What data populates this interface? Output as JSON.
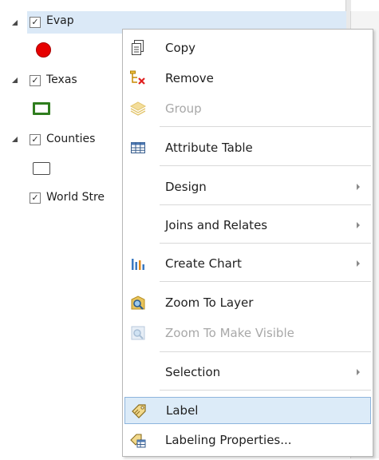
{
  "contents": {
    "layers": [
      {
        "name": "Evap",
        "checked": true,
        "expanded": true,
        "selected": true,
        "symbol": "red-circle"
      },
      {
        "name": "Texas",
        "checked": true,
        "expanded": true,
        "selected": false,
        "symbol": "green-outline-rect"
      },
      {
        "name": "Counties",
        "checked": true,
        "expanded": true,
        "selected": false,
        "symbol": "black-outline-rect"
      },
      {
        "name": "World Stre",
        "checked": true,
        "expanded": false,
        "selected": false,
        "symbol": ""
      }
    ]
  },
  "context_menu": {
    "items": [
      {
        "label": "Copy",
        "icon": "copy-icon",
        "enabled": true,
        "submenu": false
      },
      {
        "label": "Remove",
        "icon": "remove-layer-icon",
        "enabled": true,
        "submenu": false
      },
      {
        "label": "Group",
        "icon": "group-layers-icon",
        "enabled": false,
        "submenu": false
      },
      {
        "label": "Attribute Table",
        "icon": "table-icon",
        "enabled": true,
        "submenu": false
      },
      {
        "label": "Design",
        "icon": "",
        "enabled": true,
        "submenu": true
      },
      {
        "label": "Joins and Relates",
        "icon": "",
        "enabled": true,
        "submenu": true
      },
      {
        "label": "Create Chart",
        "icon": "bar-chart-icon",
        "enabled": true,
        "submenu": true
      },
      {
        "label": "Zoom To Layer",
        "icon": "zoom-to-layer-icon",
        "enabled": true,
        "submenu": false
      },
      {
        "label": "Zoom To Make Visible",
        "icon": "zoom-to-visible-icon",
        "enabled": false,
        "submenu": false
      },
      {
        "label": "Selection",
        "icon": "",
        "enabled": true,
        "submenu": true
      },
      {
        "label": "Label",
        "icon": "label-icon",
        "enabled": true,
        "submenu": false,
        "highlighted": true
      },
      {
        "label": "Labeling Properties...",
        "icon": "labeling-properties-icon",
        "enabled": true,
        "submenu": false
      }
    ]
  },
  "colors": {
    "selection": "#dbe9f7",
    "hover": "#dcebf8",
    "evap_symbol": "#e60000",
    "texas_symbol": "#2f7d1e"
  }
}
